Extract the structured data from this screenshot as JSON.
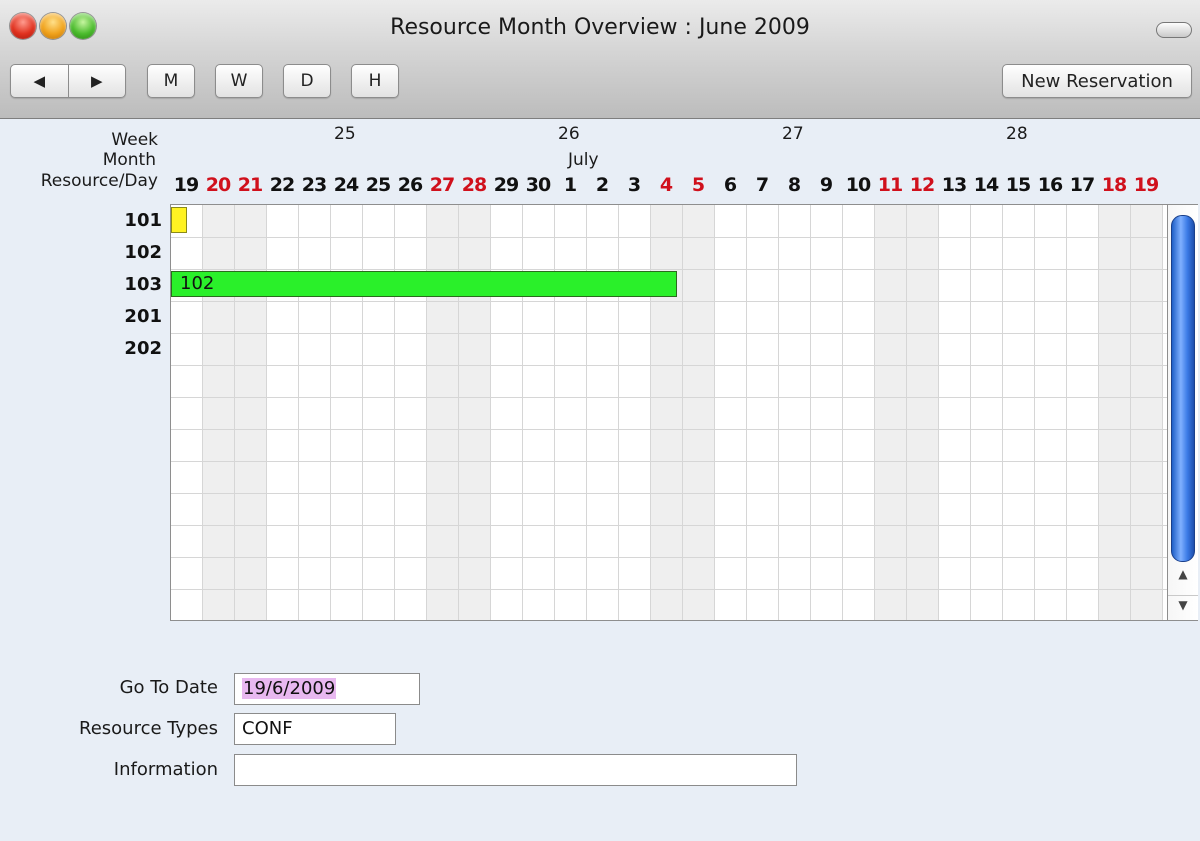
{
  "window": {
    "title": "Resource Month Overview : June 2009"
  },
  "toolbar": {
    "prev_icon": "◀",
    "next_icon": "▶",
    "m_label": "M",
    "w_label": "W",
    "d_label": "D",
    "h_label": "H",
    "new_reservation_label": "New Reservation"
  },
  "header": {
    "week_label": "Week",
    "month_label": "Month",
    "resource_day_label": "Resource/Day",
    "weeks": [
      "25",
      "26",
      "27",
      "28"
    ],
    "month_name": "July",
    "days": [
      {
        "d": "19",
        "weekend": false
      },
      {
        "d": "20",
        "weekend": true
      },
      {
        "d": "21",
        "weekend": true
      },
      {
        "d": "22",
        "weekend": false
      },
      {
        "d": "23",
        "weekend": false
      },
      {
        "d": "24",
        "weekend": false
      },
      {
        "d": "25",
        "weekend": false
      },
      {
        "d": "26",
        "weekend": false
      },
      {
        "d": "27",
        "weekend": true
      },
      {
        "d": "28",
        "weekend": true
      },
      {
        "d": "29",
        "weekend": false
      },
      {
        "d": "30",
        "weekend": false
      },
      {
        "d": "1",
        "weekend": false
      },
      {
        "d": "2",
        "weekend": false
      },
      {
        "d": "3",
        "weekend": false
      },
      {
        "d": "4",
        "weekend": true
      },
      {
        "d": "5",
        "weekend": true
      },
      {
        "d": "6",
        "weekend": false
      },
      {
        "d": "7",
        "weekend": false
      },
      {
        "d": "8",
        "weekend": false
      },
      {
        "d": "9",
        "weekend": false
      },
      {
        "d": "10",
        "weekend": false
      },
      {
        "d": "11",
        "weekend": true
      },
      {
        "d": "12",
        "weekend": true
      },
      {
        "d": "13",
        "weekend": false
      },
      {
        "d": "14",
        "weekend": false
      },
      {
        "d": "15",
        "weekend": false
      },
      {
        "d": "16",
        "weekend": false
      },
      {
        "d": "17",
        "weekend": false
      },
      {
        "d": "18",
        "weekend": true
      },
      {
        "d": "19",
        "weekend": true
      }
    ]
  },
  "resources": [
    "101",
    "102",
    "103",
    "201",
    "202"
  ],
  "reservations": [
    {
      "resource": "101",
      "label": "",
      "color": "#fff222",
      "start_day": "19",
      "end_day": "19"
    },
    {
      "resource": "103",
      "label": "102",
      "color": "#2af02a",
      "start_day": "19",
      "end_day": "4"
    }
  ],
  "form": {
    "go_to_date_label": "Go To Date",
    "go_to_date_value": "19/6/2009",
    "resource_types_label": "Resource Types",
    "resource_types_value": "CONF",
    "information_label": "Information",
    "information_value": ""
  },
  "scrollbar": {
    "up_icon": "▲",
    "down_icon": "▼"
  },
  "colors": {
    "weekend_text": "#d0101c",
    "weekend_column": "#efefef",
    "date_highlight": "#e8b8f0"
  }
}
